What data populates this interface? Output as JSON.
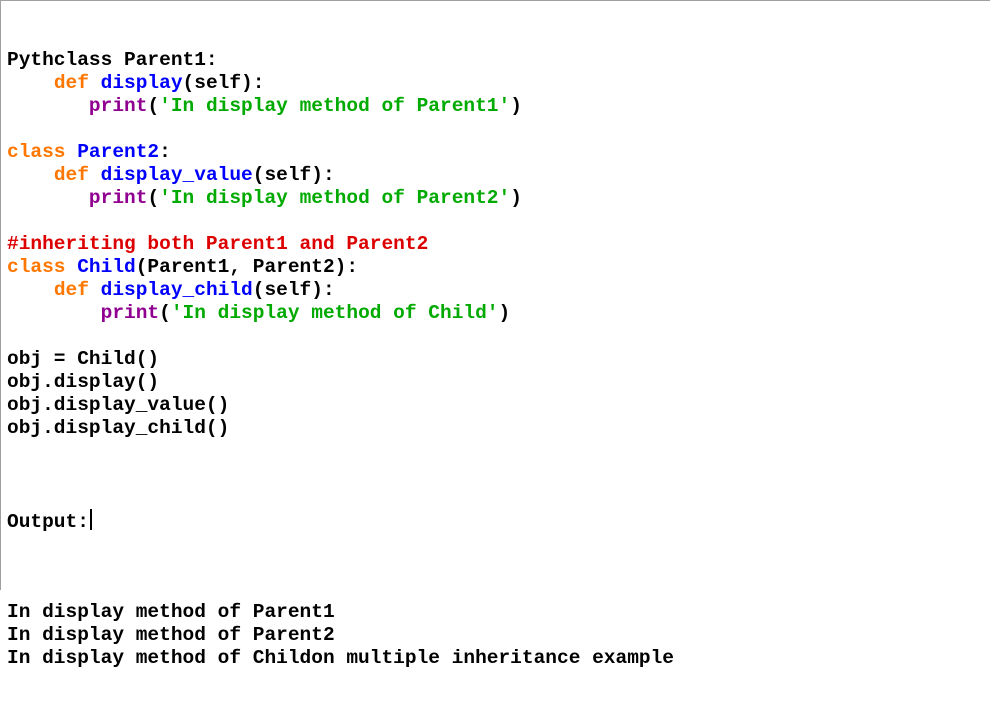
{
  "colors": {
    "keyword": "#ff7700",
    "definition": "#0000ff",
    "builtin": "#900090",
    "string": "#00aa00",
    "comment": "#dd0000",
    "text": "#000000",
    "background": "#ffffff"
  },
  "code_lines": [
    [
      {
        "t": "Pythclass Parent1:",
        "c": "pl"
      }
    ],
    [
      {
        "t": "    ",
        "c": "pl"
      },
      {
        "t": "def",
        "c": "kw"
      },
      {
        "t": " ",
        "c": "pl"
      },
      {
        "t": "display",
        "c": "fn"
      },
      {
        "t": "(self):",
        "c": "pl"
      }
    ],
    [
      {
        "t": "       ",
        "c": "pl"
      },
      {
        "t": "print",
        "c": "bi"
      },
      {
        "t": "(",
        "c": "pl"
      },
      {
        "t": "'In display method of Parent1'",
        "c": "st"
      },
      {
        "t": ")",
        "c": "pl"
      }
    ],
    [
      {
        "t": "",
        "c": "pl"
      }
    ],
    [
      {
        "t": "class",
        "c": "kw"
      },
      {
        "t": " ",
        "c": "pl"
      },
      {
        "t": "Parent2",
        "c": "fn"
      },
      {
        "t": ":",
        "c": "pl"
      }
    ],
    [
      {
        "t": "    ",
        "c": "pl"
      },
      {
        "t": "def",
        "c": "kw"
      },
      {
        "t": " ",
        "c": "pl"
      },
      {
        "t": "display_value",
        "c": "fn"
      },
      {
        "t": "(self):",
        "c": "pl"
      }
    ],
    [
      {
        "t": "       ",
        "c": "pl"
      },
      {
        "t": "print",
        "c": "bi"
      },
      {
        "t": "(",
        "c": "pl"
      },
      {
        "t": "'In display method of Parent2'",
        "c": "st"
      },
      {
        "t": ")",
        "c": "pl"
      }
    ],
    [
      {
        "t": "",
        "c": "pl"
      }
    ],
    [
      {
        "t": "#inheriting both Parent1 and Parent2",
        "c": "cm"
      }
    ],
    [
      {
        "t": "class",
        "c": "kw"
      },
      {
        "t": " ",
        "c": "pl"
      },
      {
        "t": "Child",
        "c": "fn"
      },
      {
        "t": "(Parent1, Parent2):",
        "c": "pl"
      }
    ],
    [
      {
        "t": "    ",
        "c": "pl"
      },
      {
        "t": "def",
        "c": "kw"
      },
      {
        "t": " ",
        "c": "pl"
      },
      {
        "t": "display_child",
        "c": "fn"
      },
      {
        "t": "(self):",
        "c": "pl"
      }
    ],
    [
      {
        "t": "        ",
        "c": "pl"
      },
      {
        "t": "print",
        "c": "bi"
      },
      {
        "t": "(",
        "c": "pl"
      },
      {
        "t": "'In display method of Child'",
        "c": "st"
      },
      {
        "t": ")",
        "c": "pl"
      }
    ],
    [
      {
        "t": "",
        "c": "pl"
      }
    ],
    [
      {
        "t": "obj = Child()",
        "c": "pl"
      }
    ],
    [
      {
        "t": "obj.display()",
        "c": "pl"
      }
    ],
    [
      {
        "t": "obj.display_value()",
        "c": "pl"
      }
    ],
    [
      {
        "t": "obj.display_child()",
        "c": "pl"
      }
    ],
    [
      {
        "t": "",
        "c": "pl"
      }
    ]
  ],
  "output_label": "Output:",
  "output_lines": [
    "",
    "In display method of Parent1",
    "In display method of Parent2",
    "In display method of Childon multiple inheritance example"
  ]
}
